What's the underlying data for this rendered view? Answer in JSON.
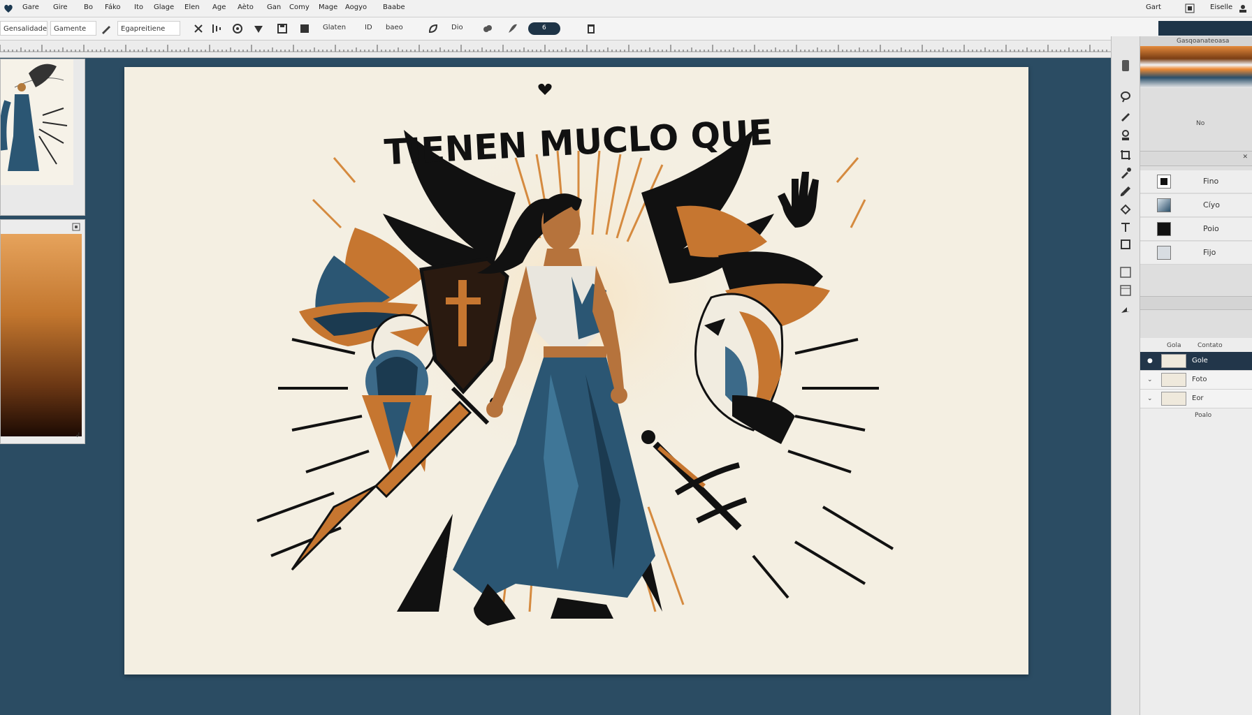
{
  "menubar": {
    "items": [
      "Gare",
      "Gire",
      "Bo",
      "Fáko",
      "Ito",
      "Glage",
      "Elen",
      "Age",
      "Aèto",
      "Gan",
      "Comy",
      "Mage",
      "Aogyo",
      "Baabe"
    ],
    "right_items": [
      "Gart",
      "Eiselle"
    ]
  },
  "toolbar": {
    "field1": "Gensalidade",
    "field2": "Gamente",
    "field3": "Egapreitiene",
    "label_glaten": "Glaten",
    "label_id": "ID",
    "label_baeo": "baeo",
    "label_dio": "Dio",
    "toggle_value": "6"
  },
  "canvas": {
    "headline": "TIENEN MUCLO QUE"
  },
  "right_panel": {
    "swatch_header": "Gasqoanateoasa",
    "swatch_caption": "No",
    "swatch_rows": [
      "Fino",
      "Cíyo",
      "Poio",
      "Fijo"
    ],
    "layers_header": [
      "Gola",
      "Contato"
    ],
    "layers": [
      "Gole",
      "Foto",
      "Eor"
    ],
    "layers_footer": "Poalo"
  },
  "colors": {
    "canvas_bg": "#f4efe2",
    "workspace": "#2b4c63",
    "accent_orange": "#c77a32",
    "navy": "#1f3d55"
  }
}
